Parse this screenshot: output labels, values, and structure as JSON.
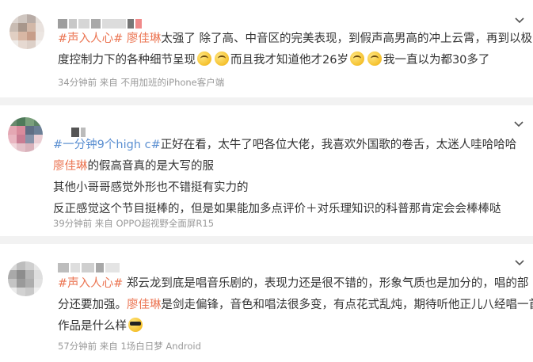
{
  "comments": [
    {
      "lines": [
        [
          {
            "t": "tag",
            "v": "#声入人心#"
          },
          {
            "t": "sp",
            "v": " "
          },
          {
            "t": "tag",
            "v": "廖佳琳"
          },
          {
            "t": "n",
            "v": "太强了 除了高、中音区的完美表现，到假声高男高的冲上云霄，再到以极"
          }
        ],
        [
          {
            "t": "n",
            "v": "度控制力下的各种细节呈现"
          },
          {
            "t": "emoji",
            "v": "smirk-emoji"
          },
          {
            "t": "emoji",
            "v": "smirk-emoji"
          },
          {
            "t": "n",
            "v": "而且我才知道他才26岁"
          },
          {
            "t": "emoji",
            "v": "smirk-emoji"
          },
          {
            "t": "emoji",
            "v": "smirk-emoji"
          },
          {
            "t": "n",
            "v": "我一直以为都30多了"
          }
        ]
      ],
      "meta": "34分钟前 来自 不用加班的iPhone客户端"
    },
    {
      "lines": [
        [
          {
            "t": "tag2",
            "v": "#一分钟9个high c#"
          },
          {
            "t": "n",
            "v": "正好在看，太牛了吧各位大佬，我喜欢外国歌的卷舌，太迷人哇哈哈哈"
          }
        ],
        [
          {
            "t": "tag",
            "v": "廖佳琳"
          },
          {
            "t": "n",
            "v": "的假高音真的是大写的服"
          }
        ],
        [
          {
            "t": "n",
            "v": "其他小哥哥感觉外形也不错挺有实力的"
          }
        ],
        [
          {
            "t": "n",
            "v": "反正感觉这个节目挺棒的，但是如果能加多点评价＋对乐理知识的科普那肯定会会棒棒哒"
          }
        ]
      ],
      "meta": "39分钟前 来自 OPPO超视野全面屏R15"
    },
    {
      "lines": [
        [
          {
            "t": "tag",
            "v": "#声入人心#"
          },
          {
            "t": "n",
            "v": " 郑云龙到底是唱音乐剧的，表现力还是很不错的，形象气质也是加分的，唱的部"
          }
        ],
        [
          {
            "t": "n",
            "v": "分还要加强。"
          },
          {
            "t": "tag",
            "v": "廖佳琳"
          },
          {
            "t": "n",
            "v": "是剑走偏锋，音色和唱法很多变，有点花式乱炖，期待听他正儿八经唱一首"
          }
        ],
        [
          {
            "t": "n",
            "v": "作品是什么样"
          },
          {
            "t": "emoji",
            "v": "cool-emoji"
          }
        ]
      ],
      "meta": "57分钟前 来自 1场白日梦 Android"
    }
  ],
  "colors": {
    "topic": "#eb7350",
    "topic_alt": "#5b8fd1",
    "meta": "#999999",
    "text": "#333333"
  }
}
